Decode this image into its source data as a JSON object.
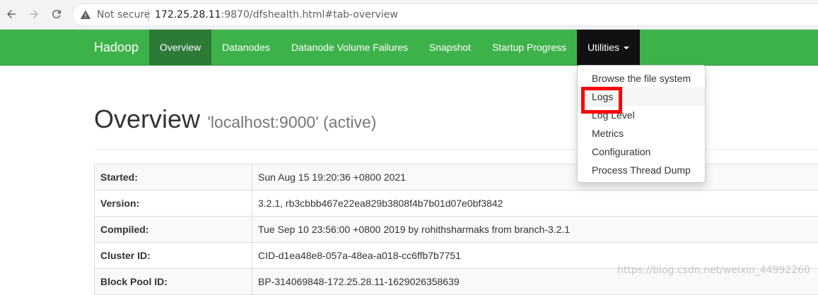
{
  "browser": {
    "security_label": "Not secure",
    "url_host": "172.25.28.11",
    "url_rest": ":9870/dfshealth.html#tab-overview"
  },
  "navbar": {
    "brand": "Hadoop",
    "items": [
      {
        "label": "Overview",
        "active": true
      },
      {
        "label": "Datanodes"
      },
      {
        "label": "Datanode Volume Failures"
      },
      {
        "label": "Snapshot"
      },
      {
        "label": "Startup Progress"
      },
      {
        "label": "Utilities",
        "open": true
      }
    ]
  },
  "utilities_menu": {
    "items": [
      {
        "label": "Browse the file system"
      },
      {
        "label": "Logs",
        "highlighted": true
      },
      {
        "label": "Log Level"
      },
      {
        "label": "Metrics"
      },
      {
        "label": "Configuration"
      },
      {
        "label": "Process Thread Dump"
      }
    ]
  },
  "page": {
    "title": "Overview",
    "subtitle": "'localhost:9000' (active)"
  },
  "info_table": {
    "rows": [
      {
        "key": "Started:",
        "value": "Sun Aug 15 19:20:36 +0800 2021"
      },
      {
        "key": "Version:",
        "value": "3.2.1, rb3cbbb467e22ea829b3808f4b7b01d07e0bf3842"
      },
      {
        "key": "Compiled:",
        "value": "Tue Sep 10 23:56:00 +0800 2019 by rohithsharmaks from branch-3.2.1"
      },
      {
        "key": "Cluster ID:",
        "value": "CID-d1ea48e8-057a-48ea-a018-cc6ffb7b7751"
      },
      {
        "key": "Block Pool ID:",
        "value": "BP-314069848-172.25.28.11-1629026358639"
      }
    ]
  },
  "watermark": "https://blog.csdn.net/weixin_44992260",
  "colors": {
    "navbar_bg": "#3eb24a",
    "navbar_active": "#2d7a37",
    "dropdown_open": "#111111",
    "highlight": "#ff0000"
  }
}
